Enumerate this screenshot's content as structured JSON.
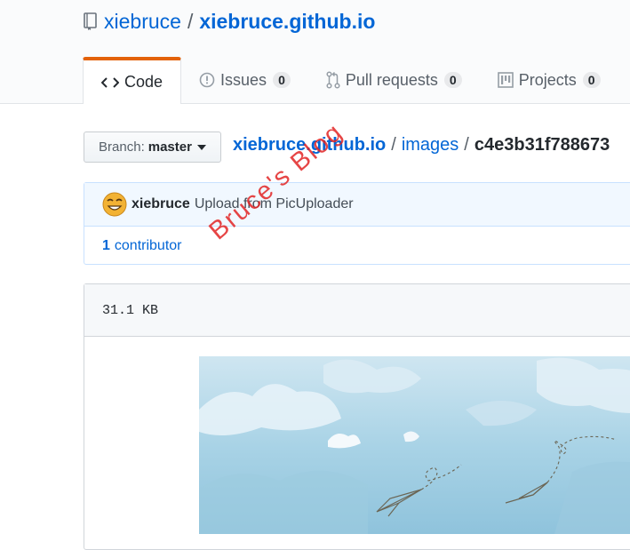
{
  "repo": {
    "owner": "xiebruce",
    "separator": "/",
    "name": "xiebruce.github.io"
  },
  "tabs": [
    {
      "label": "Code",
      "icon": "code-icon"
    },
    {
      "label": "Issues",
      "count": "0",
      "icon": "issue-opened-icon"
    },
    {
      "label": "Pull requests",
      "count": "0",
      "icon": "git-pull-request-icon"
    },
    {
      "label": "Projects",
      "count": "0",
      "icon": "project-icon"
    }
  ],
  "branch": {
    "label": "Branch:",
    "name": "master"
  },
  "breadcrumb": {
    "root": "xiebruce.github.io",
    "folder": "images",
    "file": "c4e3b31f788673",
    "separator": "/"
  },
  "commit": {
    "author": "xiebruce",
    "message": "Upload from PicUploader"
  },
  "contributors": {
    "count": "1",
    "label": "contributor"
  },
  "file": {
    "size": "31.1 KB"
  },
  "watermark": "Bruce's Blog",
  "colors": {
    "link": "#0366d6",
    "tab_accent": "#e36209",
    "watermark": "#e22424",
    "sky": "#a9d3e6"
  }
}
